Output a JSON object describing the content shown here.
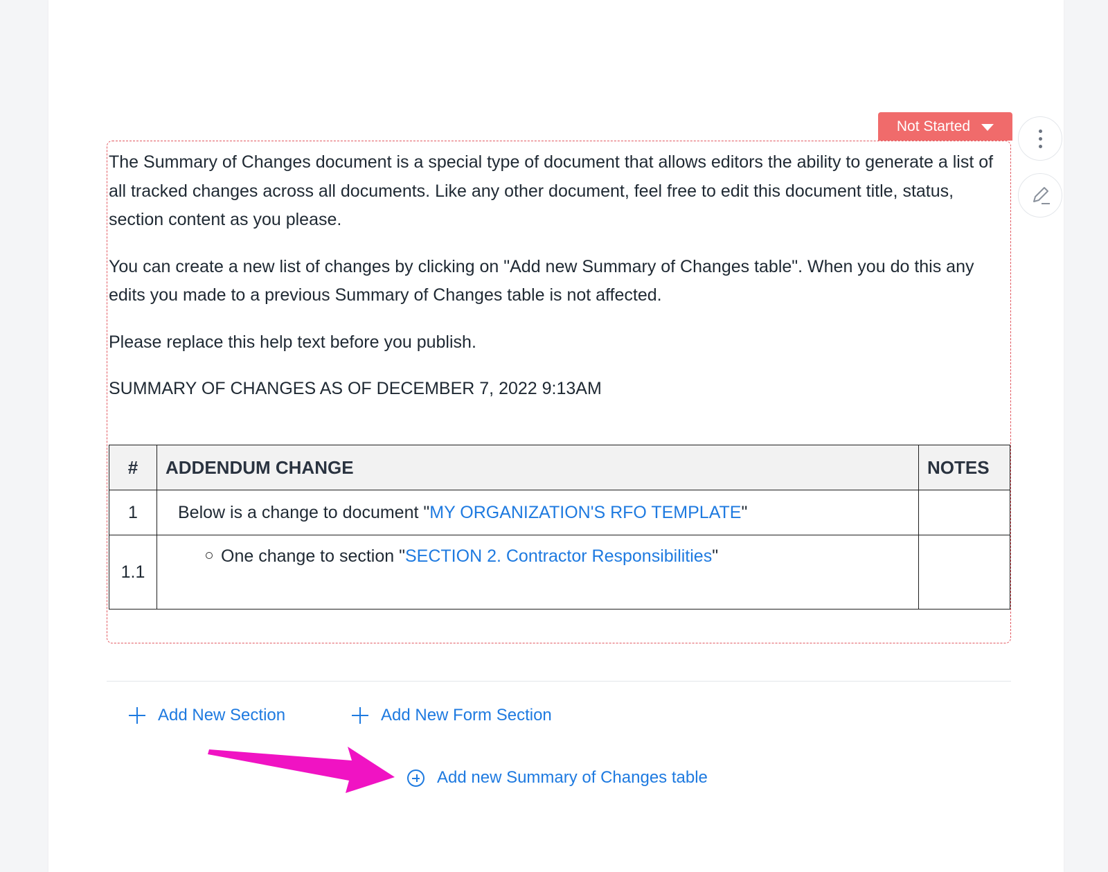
{
  "status": {
    "label": "Not Started",
    "color": "#f06b6b"
  },
  "actions": {
    "more": "more-options",
    "edit": "edit"
  },
  "help_text": [
    "The Summary of Changes document is a special type of document that allows editors the ability to generate a list of all tracked changes across all documents. Like any other document, feel free to edit this document title, status, section content as you please.",
    "You can create a new list of changes by clicking on \"Add new Summary of Changes table\". When you do this any edits you made to a previous Summary of Changes table is not affected.",
    "Please replace this help text before you publish."
  ],
  "summary_heading": "SUMMARY OF CHANGES AS OF DECEMBER 7, 2022 9:13AM",
  "table": {
    "headers": [
      "#",
      "ADDENDUM CHANGE",
      "NOTES"
    ],
    "rows": [
      {
        "num": "1",
        "prefix": "Below is a change to document \"",
        "link": "MY ORGANIZATION'S RFO TEMPLATE",
        "suffix": "\"",
        "notes": ""
      },
      {
        "num": "1.1",
        "prefix": "One change to section \"",
        "link": "SECTION 2. Contractor Responsibilities",
        "suffix": "\"",
        "notes": ""
      }
    ]
  },
  "footer_actions": {
    "add_section": "Add New Section",
    "add_form_section": "Add New Form Section",
    "add_summary_table": "Add new Summary of Changes table"
  },
  "colors": {
    "link": "#1e7ae0",
    "annotation_arrow": "#f013c3"
  }
}
